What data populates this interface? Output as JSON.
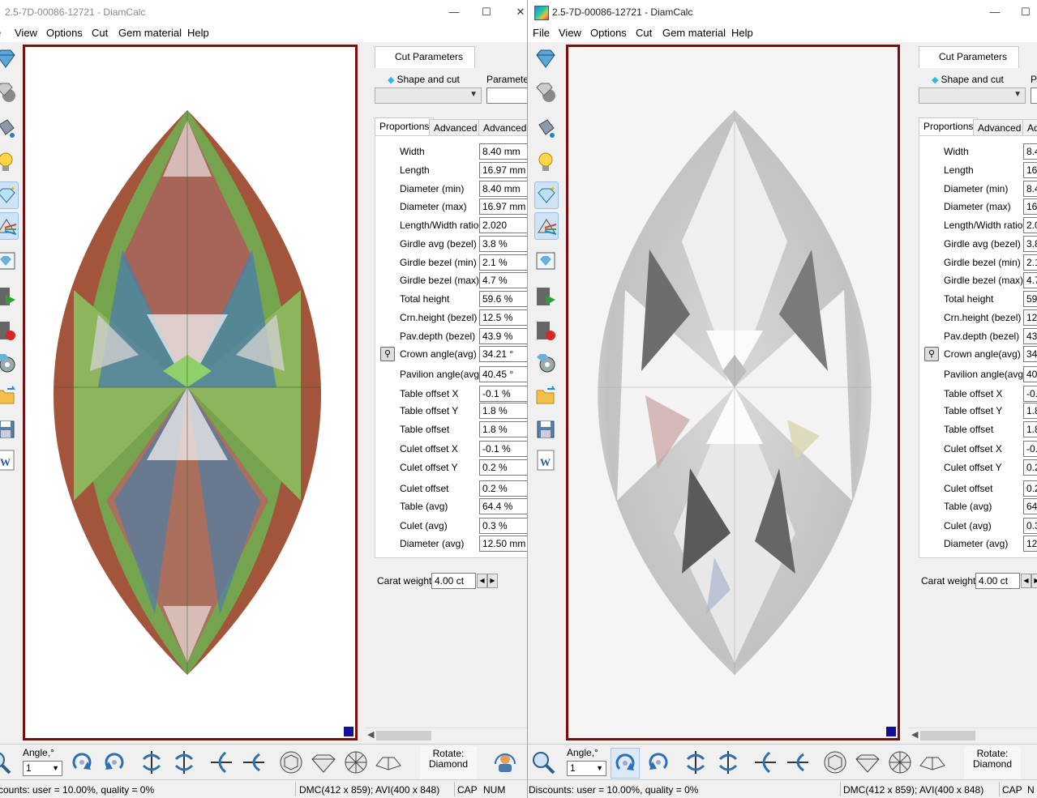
{
  "left_window": {
    "title": "2.5-7D-00086-12721 - DiamCalc",
    "menu": [
      "View",
      "Options",
      "Cut",
      "Gem material",
      "Help"
    ],
    "panel": {
      "cut_tab": "Cut Parameters",
      "shape_label": "Shape and cut",
      "parameters_label": "Parameter",
      "subtabs": [
        "Proportions",
        "Advanced",
        "Advanced"
      ],
      "props": [
        {
          "label": "Width",
          "value": "8.40 mm"
        },
        {
          "label": "Length",
          "value": "16.97 mm"
        },
        {
          "label": "Diameter (min)",
          "value": "8.40 mm"
        },
        {
          "label": "Diameter (max)",
          "value": "16.97 mm"
        },
        {
          "label": "Length/Width ratio",
          "value": "2.020"
        },
        {
          "label": "Girdle avg (bezel)",
          "value": "3.8 %"
        },
        {
          "label": "Girdle bezel (min)",
          "value": "2.1 %"
        },
        {
          "label": "Girdle bezel (max)",
          "value": "4.7 %"
        },
        {
          "label": "Total height",
          "value": "59.6 %"
        },
        {
          "label": "Crn.height (bezel)",
          "value": "12.5 %"
        },
        {
          "label": "Pav.depth (bezel)",
          "value": "43.9 %"
        },
        {
          "label": "Crown angle(avg)",
          "value": "34.21 °"
        },
        {
          "label": "Pavilion angle(avg)",
          "value": "40.45 °"
        },
        {
          "label": "Table offset X",
          "value": "-0.1 %"
        },
        {
          "label": "Table offset Y",
          "value": "1.8 %"
        },
        {
          "label": "Table offset",
          "value": "1.8 %"
        },
        {
          "label": "Culet offset X",
          "value": "-0.1 %"
        },
        {
          "label": "Culet offset Y",
          "value": "0.2 %"
        },
        {
          "label": "Culet offset",
          "value": "0.2 %"
        },
        {
          "label": "Table (avg)",
          "value": "64.4 %"
        },
        {
          "label": "Culet (avg)",
          "value": "0.3 %"
        },
        {
          "label": "Diameter (avg)",
          "value": "12.50 mm"
        }
      ],
      "carat_label": "Carat weight",
      "carat_value": "4.00 ct"
    },
    "bottombar": {
      "angle_label": "Angle,°",
      "angle_value": "1",
      "rotate_line1": "Rotate:",
      "rotate_line2": "Diamond"
    },
    "status": {
      "discounts": "counts: user = 10.00%, quality = 0%",
      "dims": "DMC(412 x 859); AVI(400 x 848)",
      "cap": "CAP",
      "num": "NUM"
    }
  },
  "right_window": {
    "title": "2.5-7D-00086-12721 - DiamCalc",
    "menu": [
      "File",
      "View",
      "Options",
      "Cut",
      "Gem material",
      "Help"
    ],
    "panel": {
      "cut_tab": "Cut Parameters",
      "shape_label": "Shape and cut",
      "parameters_label": "P",
      "subtabs": [
        "Proportions",
        "Advanced",
        "Ad"
      ],
      "props": [
        {
          "label": "Width",
          "value": "8.4"
        },
        {
          "label": "Length",
          "value": "16"
        },
        {
          "label": "Diameter (min)",
          "value": "8.4"
        },
        {
          "label": "Diameter (max)",
          "value": "16"
        },
        {
          "label": "Length/Width ratio",
          "value": "2.0"
        },
        {
          "label": "Girdle avg (bezel)",
          "value": "3.8"
        },
        {
          "label": "Girdle bezel (min)",
          "value": "2.1"
        },
        {
          "label": "Girdle bezel (max)",
          "value": "4.7"
        },
        {
          "label": "Total height",
          "value": "59"
        },
        {
          "label": "Crn.height (bezel)",
          "value": "12"
        },
        {
          "label": "Pav.depth (bezel)",
          "value": "43"
        },
        {
          "label": "Crown angle(avg)",
          "value": "34"
        },
        {
          "label": "Pavilion angle(avg)",
          "value": "40"
        },
        {
          "label": "Table offset X",
          "value": "-0."
        },
        {
          "label": "Table offset Y",
          "value": "1.8"
        },
        {
          "label": "Table offset",
          "value": "1.8"
        },
        {
          "label": "Culet offset X",
          "value": "-0."
        },
        {
          "label": "Culet offset Y",
          "value": "0.2"
        },
        {
          "label": "Culet offset",
          "value": "0.2"
        },
        {
          "label": "Table (avg)",
          "value": "64"
        },
        {
          "label": "Culet (avg)",
          "value": "0.3"
        },
        {
          "label": "Diameter (avg)",
          "value": "12"
        }
      ],
      "carat_label": "Carat weight",
      "carat_value": "4.00 ct"
    },
    "bottombar": {
      "angle_label": "Angle,°",
      "angle_value": "1",
      "rotate_line1": "Rotate:",
      "rotate_line2": "Diamond"
    },
    "status": {
      "discounts": "Discounts: user = 10.00%, quality = 0%",
      "dims": "DMC(412 x 859); AVI(400 x 848)",
      "cap": "CAP",
      "num": "N"
    }
  },
  "icons": {
    "toolbar": [
      "diamond-view-icon",
      "gem-sphere-icon",
      "paint-bucket-icon",
      "lightbulb-icon",
      "sparkle-diamond-icon",
      "prism-icon",
      "diamond-photo-icon",
      "play-film-icon",
      "record-film-icon",
      "film-reel-icon",
      "open-folder-icon",
      "save-disk-icon",
      "word-doc-icon"
    ],
    "bottom": [
      "zoom-icon",
      "rotate-cw-icon",
      "rotate-ccw-icon",
      "flip-horizontal-icon",
      "flip-horizontal-alt-icon",
      "flip-vertical-icon",
      "flip-vertical-alt-icon",
      "top-view-icon",
      "side-view-icon",
      "bottom-view-icon",
      "wire-view-icon",
      "user-rotate-icon"
    ]
  },
  "colors": {
    "frame": "#7a0f0f",
    "marker": "#10109a",
    "accent": "#2bb8e8"
  }
}
